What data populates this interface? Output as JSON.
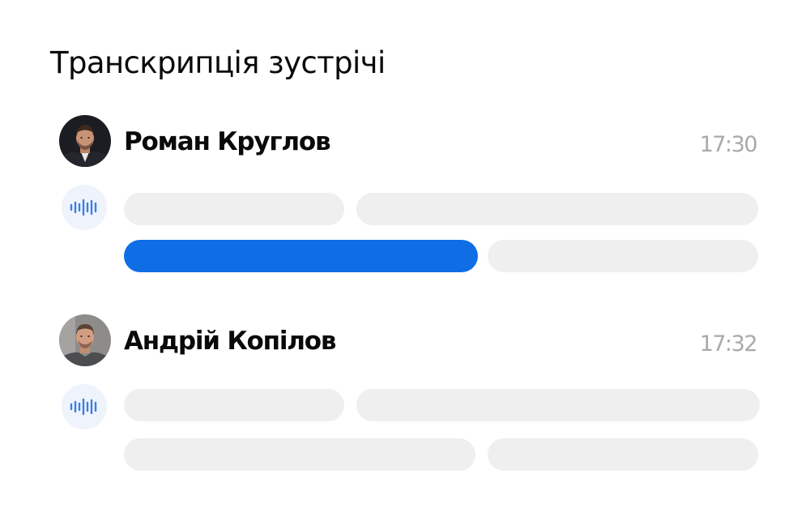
{
  "page": {
    "title": "Транскрипція зустрічі"
  },
  "entries": [
    {
      "speaker": "Роман Круглов",
      "time": "17:30",
      "avatar_icon": "person-photo-dark",
      "audio_icon": "sound-wave-icon",
      "playback_progress": 0.6
    },
    {
      "speaker": "Андрій Копілов",
      "time": "17:32",
      "avatar_icon": "person-photo-light",
      "audio_icon": "sound-wave-icon",
      "playback_progress": 0
    }
  ],
  "colors": {
    "accent": "#0f6de6",
    "placeholder_bar": "#efefef",
    "audio_badge_bg": "#eef3fc",
    "wave_icon": "#3d7fe0",
    "timestamp": "#a9a9a9",
    "text": "#0a0a0a"
  }
}
